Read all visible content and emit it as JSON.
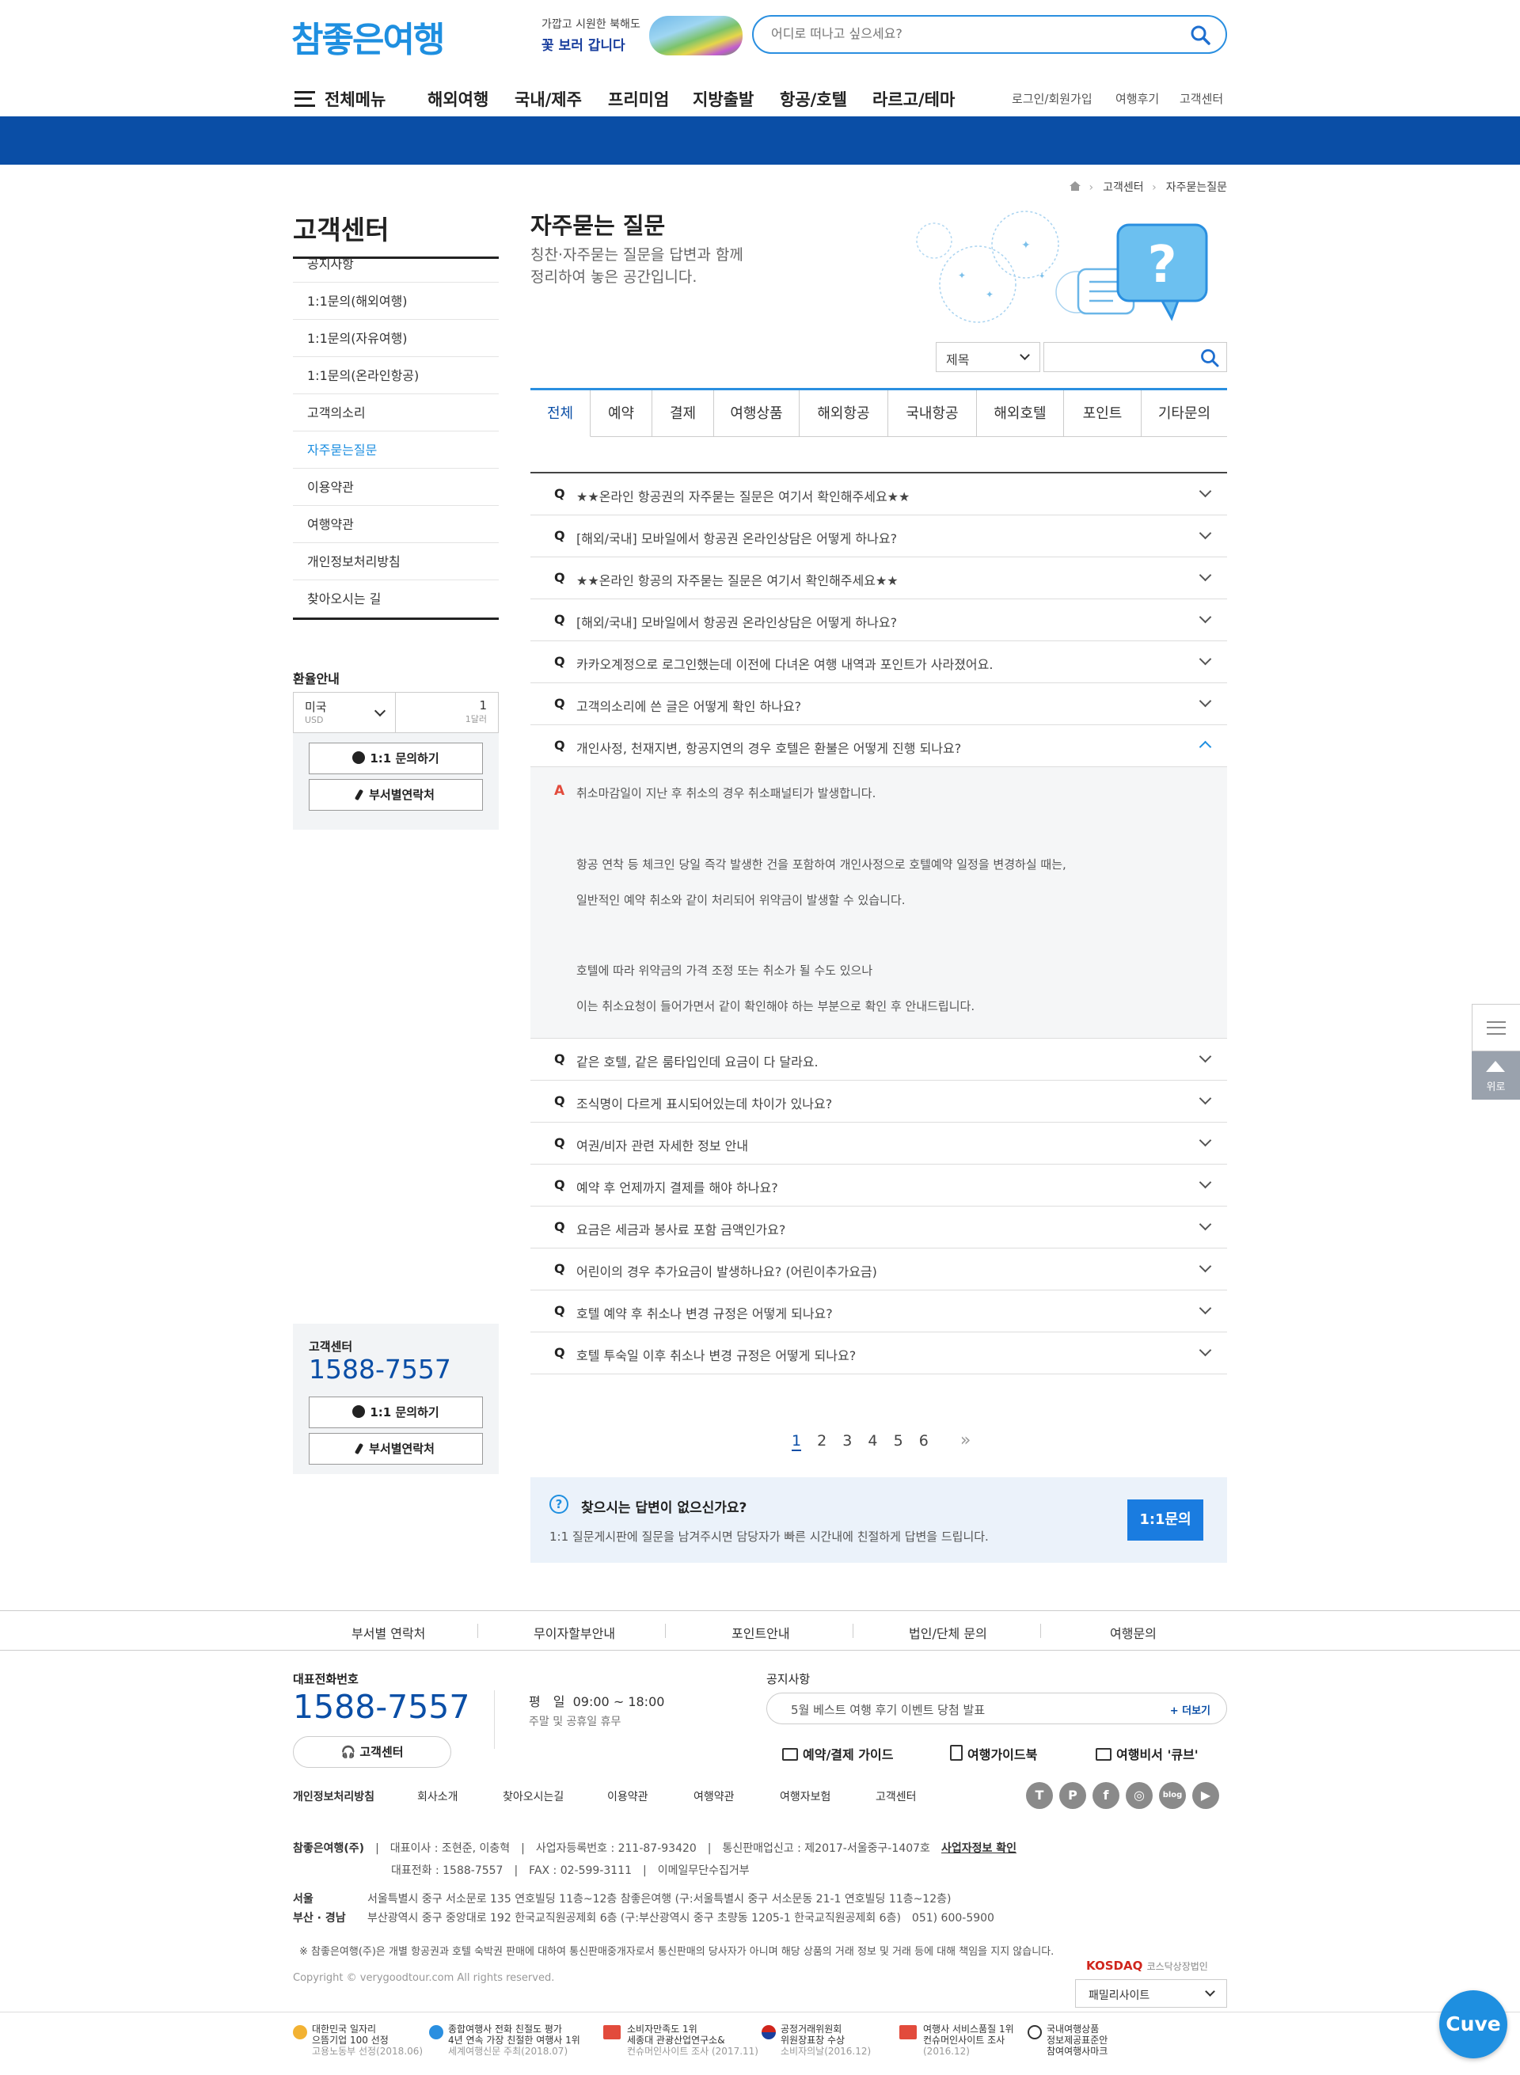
{
  "header": {
    "logo": "참좋은여행",
    "promo_line1": "가깝고 시원한 북해도",
    "promo_line2": "꽃 보러 갑니다",
    "search_placeholder": "어디로 떠나고 싶으세요?",
    "all_menu": "전체메뉴",
    "menu": [
      "해외여행",
      "국내/제주",
      "프리미엄",
      "지방출발",
      "항공/호텔",
      "라르고/테마"
    ],
    "util": [
      "로그인/회원가입",
      "여행후기",
      "고객센터"
    ]
  },
  "breadcrumb": [
    "고객센터",
    "자주묻는질문"
  ],
  "sidebar": {
    "title": "고객센터",
    "items": [
      "공지사항",
      "1:1문의(해외여행)",
      "1:1문의(자유여행)",
      "1:1문의(온라인항공)",
      "고객의소리",
      "자주묻는질문",
      "이용약관",
      "여행약관",
      "개인정보처리방침",
      "찾아오시는 길"
    ],
    "active_index": 5,
    "exchange_title": "환율안내",
    "exchange_country": "미국",
    "exchange_code": "USD",
    "exchange_value": "1",
    "exchange_unit": "1달러",
    "btn_inquiry": "1:1 문의하기",
    "btn_contact": "부서별연락처",
    "cc_title": "고객센터",
    "cc_phone": "1588-7557"
  },
  "content": {
    "title": "자주묻는 질문",
    "desc_line1": "칭찬·자주묻는 질문을 답변과 함께",
    "desc_line2": "정리하여 놓은 공간입니다.",
    "filter_select": "제목",
    "search_input": "",
    "tabs": [
      "전체",
      "예약",
      "결제",
      "여행상품",
      "해외항공",
      "국내항공",
      "해외호텔",
      "포인트",
      "기타문의"
    ],
    "active_tab": 0,
    "q_label": "Q",
    "a_label": "A",
    "faqs_before": [
      "★★온라인 항공권의 자주묻는 질문은 여기서 확인해주세요★★",
      "[해외/국내] 모바일에서 항공권 온라인상담은 어떻게 하나요?",
      "★★온라인 항공의 자주묻는 질문은 여기서 확인해주세요★★",
      "[해외/국내] 모바일에서 항공권 온라인상담은 어떻게 하나요?",
      "카카오계정으로 로그인했는데 이전에 다녀온 여행 내역과 포인트가 사라졌어요.",
      "고객의소리에 쓴 글은 어떻게 확인 하나요?",
      "개인사정, 천재지변, 항공지연의 경우 호텔은 환불은 어떻게 진행 되나요?"
    ],
    "answer": [
      "취소마감일이 지난 후 취소의 경우 취소패널티가 발생합니다.",
      "항공 연착 등 체크인 당일 즉각 발생한 건을 포함하여 개인사정으로 호텔예약 일정을 변경하실 때는,",
      "일반적인 예약 취소와 같이 처리되어 위약금이 발생할 수 있습니다.",
      "호텔에 따라 위약금의 가격 조정 또는 취소가 될 수도 있으나",
      "이는 취소요청이 들어가면서 같이 확인해야 하는 부분으로 확인 후 안내드립니다."
    ],
    "faqs_after": [
      "같은 호텔, 같은 룸타입인데 요금이 다 달라요.",
      "조식명이 다르게 표시되어있는데 차이가 있나요?",
      "여권/비자 관련 자세한 정보 안내",
      "예약 후 언제까지 결제를 해야 하나요?",
      "요금은 세금과 봉사료 포함 금액인가요?",
      "어린이의 경우 추가요금이 발생하나요? (어린이추가요금)",
      "호텔 예약 후 취소나 변경 규정은 어떻게 되나요?",
      "호텔 투숙일 이후 취소나 변경 규정은 어떻게 되나요?"
    ],
    "pages": [
      "1",
      "2",
      "3",
      "4",
      "5",
      "6"
    ],
    "current_page": "1",
    "next": "»",
    "qna_title": "찾으시는 답변이 없으신가요?",
    "qna_desc": "1:1 질문게시판에 질문을 남겨주시면 담당자가 빠른 시간내에 친절하게 답변을 드립니다.",
    "qna_button": "1:1문의",
    "qna_icon": "?"
  },
  "quick": {
    "top_label": "위로"
  },
  "footer": {
    "nav": [
      "부서별 연락처",
      "무이자할부안내",
      "포인트안내",
      "법인/단체 문의",
      "여행문의"
    ],
    "tel_label": "대표전화번호",
    "tel": "1588-7557",
    "cc_button": "고객센터",
    "hours_label": "평　일",
    "hours": "09:00 ~ 18:00",
    "holiday": "주말 및 공휴일 휴무",
    "notice_label": "공지사항",
    "notice": "5월 베스트 여행 후기 이벤트 당첨 발표",
    "more": "+ 더보기",
    "guides": [
      "예약/결제 가이드",
      "여행가이드북",
      "여행비서 '큐브'"
    ],
    "links": [
      "개인정보처리방침",
      "회사소개",
      "찾아오시는길",
      "이용약관",
      "여행약관",
      "여행자보험",
      "고객센터"
    ],
    "sns": [
      "T",
      "P",
      "f",
      "◎",
      "blog",
      "▶"
    ],
    "company": "참좋은여행(주)",
    "ceo": "대표이사 : 조현준, 이충혁",
    "bizno": "사업자등록번호 : 211-87-93420",
    "mailorder": "통신판매업신고 : 제2017-서울중구-1407호",
    "bizinfo": "사업자정보 확인",
    "phone": "대표전화 : 1588-7557",
    "fax": "FAX : 02-599-3111",
    "email": "이메일무단수집거부",
    "seoul_label": "서울",
    "seoul_addr": "서울특별시 중구 서소문로 135 연호빌딩 11층~12층 참좋은여행 (구:서울특별시 중구 서소문동 21-1 연호빌딩 11층~12층)",
    "busan_label": "부산 · 경남",
    "busan_addr": "부산광역시 중구 중앙대로 192 한국교직원공제회 6층 (구:부산광역시 중구 초량동 1205-1 한국교직원공제회 6층)　051) 600-5900",
    "disclaimer": "※ 참좋은여행(주)은 개별 항공권과 호텔 숙박권 판매에 대하여 통신판매중개자로서 통신판매의 당사자가 아니며 해당 상품의 거래 정보 및 거래 등에 대해 책임을 지지 않습니다.",
    "copyright": "Copyright © verygoodtour.com All rights reserved.",
    "kosdaq": "KOSDAQ",
    "kosdaq_sub": "코스닥상장법인",
    "family_site": "패밀리사이트",
    "awards": [
      {
        "l1": "대한민국 일자리",
        "l2": "으뜸기업 100 선정",
        "l3": "고용노동부 선정(2018.06)"
      },
      {
        "l1": "종합여행사 전화 친절도 평가",
        "l2": "4년 연속 가장 친절한 여행사 1위",
        "l3": "세계여행신문 주최(2018.07)"
      },
      {
        "l1": "소비자만족도 1위",
        "l2": "세종대 관광산업연구소&",
        "l3": "컨슈머인사이트 조사 (2017.11)"
      },
      {
        "l1": "공정거래위원회",
        "l2": "위원장표창 수상",
        "l3": "소비자의날(2016.12)"
      },
      {
        "l1": "여행사 서비스품질 1위",
        "l2": "컨슈머인사이트 조사",
        "l3": "(2016.12)"
      },
      {
        "l1": "국내여행상품",
        "l2": "정보제공표준안",
        "l3": "참여여행사마크"
      }
    ],
    "cuve": "Cuve"
  }
}
